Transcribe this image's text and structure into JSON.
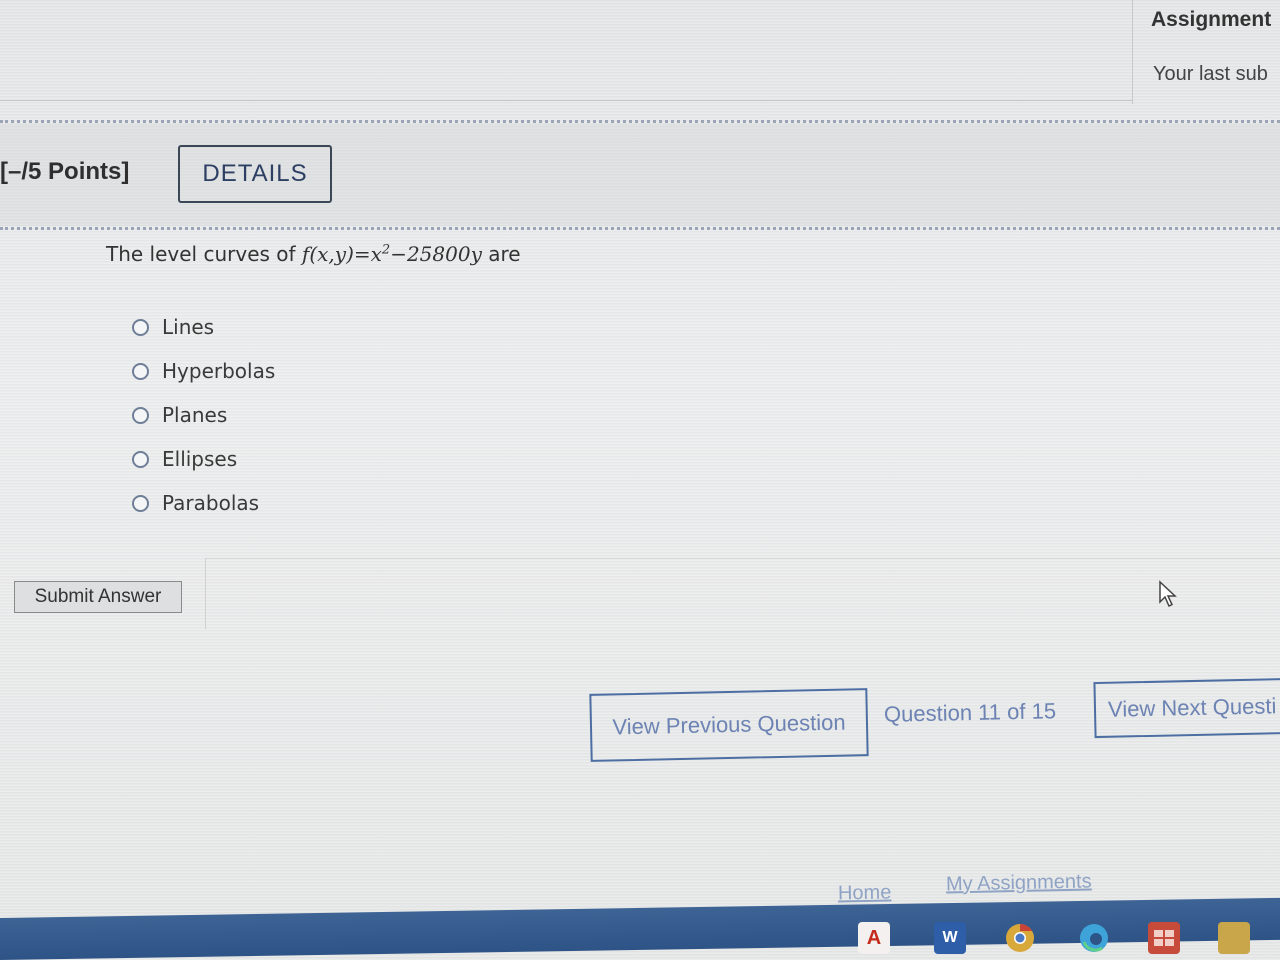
{
  "sidebar": {
    "title": "Assignment",
    "last_submission": "Your last sub"
  },
  "question_header": {
    "points": "[–/5 Points]",
    "details_label": "DETAILS"
  },
  "question": {
    "prefix": "The level curves of",
    "function": "f(x,y)=x",
    "exponent": "2",
    "function_rest": "−25800y",
    "suffix": "are",
    "options": [
      "Lines",
      "Hyperbolas",
      "Planes",
      "Ellipses",
      "Parabolas"
    ],
    "selected": null
  },
  "actions": {
    "submit_label": "Submit Answer"
  },
  "navigation": {
    "prev_label": "View Previous Question",
    "counter": "Question 11 of 15",
    "next_label": "View Next Questi"
  },
  "footer": {
    "home": "Home",
    "my_assignments": "My Assignments"
  },
  "taskbar": {
    "icons": [
      "acrobat-icon",
      "word-icon",
      "chrome-icon",
      "edge-icon",
      "store-icon",
      "folder-icon"
    ],
    "acrobat_letter": "A",
    "word_letter": "W"
  },
  "colors": {
    "link": "#6c83b3",
    "border_accent": "#4c6ea3",
    "taskbar": "#2e5386"
  }
}
